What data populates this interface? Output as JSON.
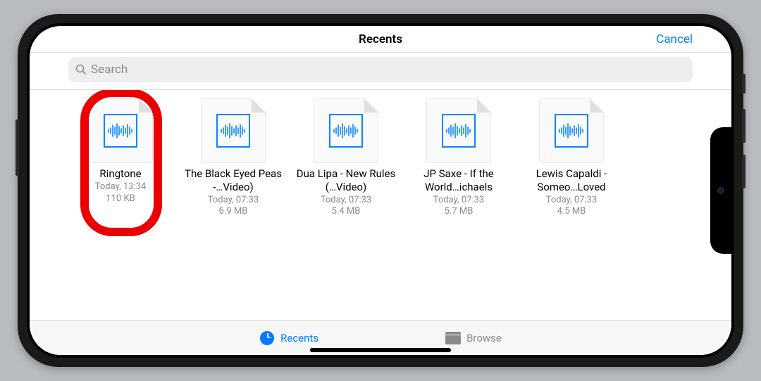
{
  "header": {
    "title": "Recents",
    "cancel_label": "Cancel"
  },
  "search": {
    "placeholder": "Search"
  },
  "files": [
    {
      "name": "Ringtone",
      "date": "Today, 13:34",
      "size": "110 KB",
      "highlighted": true
    },
    {
      "name": "The Black Eyed Peas -…Video)",
      "date": "Today, 07:33",
      "size": "6.9 MB",
      "highlighted": false
    },
    {
      "name": "Dua Lipa - New Rules (…Video)",
      "date": "Today, 07:33",
      "size": "5.4 MB",
      "highlighted": false
    },
    {
      "name": "JP Saxe - If the World…ichaels",
      "date": "Today, 07:33",
      "size": "5.7 MB",
      "highlighted": false
    },
    {
      "name": "Lewis Capaldi - Someo…Loved",
      "date": "Today, 07:33",
      "size": "4.5 MB",
      "highlighted": false
    }
  ],
  "tabs": {
    "recents_label": "Recents",
    "browse_label": "Browse",
    "active": "recents"
  }
}
